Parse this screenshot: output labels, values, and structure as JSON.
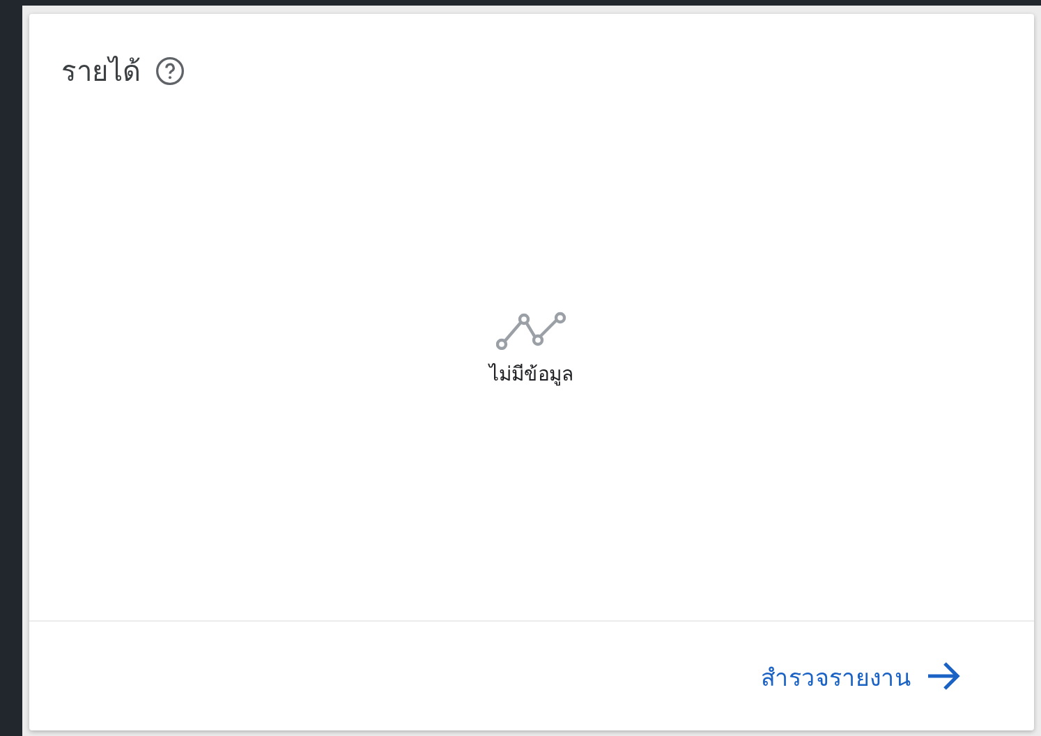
{
  "card": {
    "title": "รายได้",
    "empty_state": {
      "message": "ไม่มีข้อมูล"
    },
    "footer_link": {
      "label": "สำรวจรายงาน"
    }
  }
}
